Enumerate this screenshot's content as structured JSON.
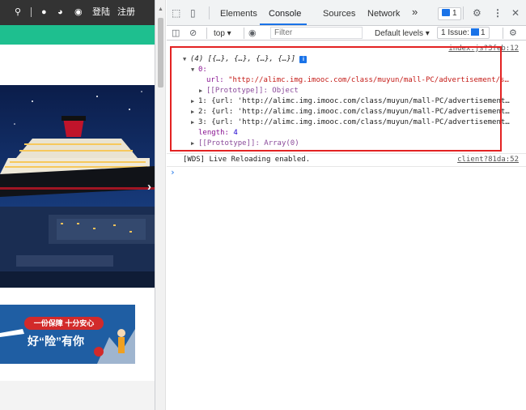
{
  "site": {
    "topbar": {
      "search_icon": "search-icon",
      "qq_icon": "qq-icon",
      "weibo_icon": "weibo-icon",
      "wechat_icon": "wechat-icon",
      "login_label": "登陆",
      "register_label": "注册"
    },
    "nav_color": "#1ebf8f",
    "banner": {
      "next_arrow": "›"
    },
    "ad": {
      "pill_text": "一份保障 十分安心",
      "slogan": "好“险”有你"
    }
  },
  "devtools": {
    "tabs": {
      "elements": "Elements",
      "console": "Console",
      "sources": "Sources",
      "network": "Network",
      "more": "»",
      "message_count": "1"
    },
    "toolbar": {
      "context": "top",
      "filter_placeholder": "Filter",
      "levels": "Default levels",
      "issues_prefix": "1 Issue:",
      "issues_count": "1"
    },
    "console": {
      "source1": "index.js?3feb:12",
      "summary": "(4) [{…}, {…}, {…}, {…}]",
      "info_badge": "i",
      "item0_key": "0:",
      "item0_url_key": "url:",
      "item0_url_val": "\"http://alimc.img.imooc.com/class/muyun/mall-PC/advertisement/s…",
      "proto_obj": "[[Prototype]]: Object",
      "item1": "1: {url: 'http://alimc.img.imooc.com/class/muyun/mall-PC/advertisement…",
      "item2": "2: {url: 'http://alimc.img.imooc.com/class/muyun/mall-PC/advertisement…",
      "item3": "3: {url: 'http://alimc.img.imooc.com/class/muyun/mall-PC/advertisement…",
      "length_key": "length:",
      "length_val": "4",
      "proto_arr": "[[Prototype]]: Array(0)",
      "wds": "[WDS] Live Reloading enabled.",
      "source2": "client?81da:52",
      "prompt": "›"
    }
  }
}
